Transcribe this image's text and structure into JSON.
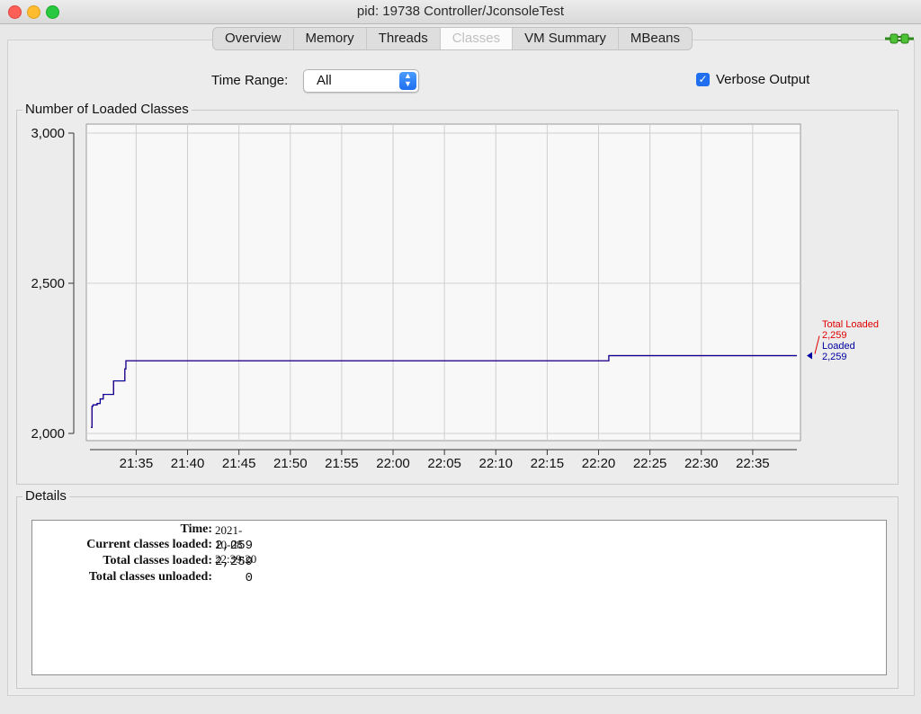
{
  "window": {
    "title": "pid: 19738 Controller/JconsoleTest"
  },
  "tabs": [
    "Overview",
    "Memory",
    "Threads",
    "Classes",
    "VM Summary",
    "MBeans"
  ],
  "active_tab": "Classes",
  "toolbar": {
    "time_range_label": "Time Range:",
    "time_range_value": "All",
    "verbose_label": "Verbose Output",
    "verbose_checked": true
  },
  "chart_section": {
    "title": "Number of Loaded Classes"
  },
  "chart_data": {
    "type": "line",
    "title": "Number of Loaded Classes",
    "ylim": [
      2000,
      3000
    ],
    "y_ticks": [
      "2,000",
      "2,500",
      "3,000"
    ],
    "x_ticks": [
      "21:35",
      "21:40",
      "21:45",
      "21:50",
      "21:55",
      "22:00",
      "22:05",
      "22:10",
      "22:15",
      "22:20",
      "22:25",
      "22:30",
      "22:35"
    ],
    "xlim_minutes": [
      "21:30.5",
      "22:39.3"
    ],
    "series": [
      {
        "name": "Loaded",
        "color": "#0000a0",
        "x": [
          "21:30.6",
          "21:30.7",
          "21:30.8",
          "21:31.2",
          "21:31.5",
          "21:31.8",
          "21:32.3",
          "21:32.8",
          "21:33.3",
          "21:33.9",
          "21:34.0",
          "22:20.9",
          "22:21.0",
          "22:39.3"
        ],
        "y": [
          2020,
          2090,
          2095,
          2100,
          2115,
          2130,
          2130,
          2175,
          2175,
          2215,
          2242,
          2242,
          2259,
          2259
        ]
      },
      {
        "name": "Total Loaded",
        "color": "#e00000",
        "x": [
          "21:30.6",
          "21:30.7",
          "21:30.8",
          "21:31.2",
          "21:31.5",
          "21:31.8",
          "21:32.3",
          "21:32.8",
          "21:33.3",
          "21:33.9",
          "21:34.0",
          "22:20.9",
          "22:21.0",
          "22:39.3"
        ],
        "y": [
          2020,
          2090,
          2095,
          2100,
          2115,
          2130,
          2130,
          2175,
          2175,
          2215,
          2242,
          2242,
          2259,
          2259
        ]
      }
    ],
    "legend": [
      {
        "name": "Total Loaded",
        "value": "2,259",
        "color": "#e00000"
      },
      {
        "name": "Loaded",
        "value": "2,259",
        "color": "#0000a0"
      }
    ],
    "grid": true,
    "legend_position": "right"
  },
  "details": {
    "title": "Details",
    "rows": [
      {
        "label": "Time:",
        "value": "2021-10-08 22:39:20"
      },
      {
        "label": "Current classes loaded:",
        "value": "2,259"
      },
      {
        "label": "Total classes loaded:",
        "value": "2,259"
      },
      {
        "label": "Total classes unloaded:",
        "value": "0"
      }
    ]
  }
}
